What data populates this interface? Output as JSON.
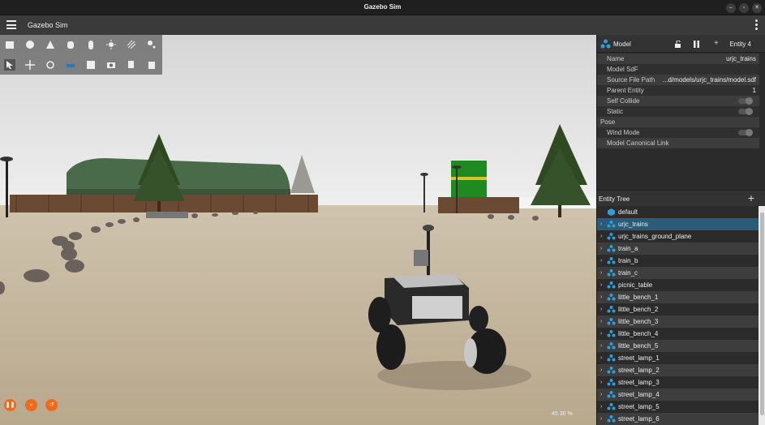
{
  "window": {
    "title": "Gazebo Sim"
  },
  "app": {
    "name": "Gazebo Sim"
  },
  "colors": {
    "accent": "#f06a1c",
    "selection": "#2a5b78",
    "panel": "#2b2b2b"
  },
  "toolbar": {
    "row1": [
      "box-icon",
      "sphere-icon",
      "cone-icon",
      "cylinder-icon",
      "capsule-icon",
      "sun-icon",
      "directional-light-icon",
      "spot-light-icon"
    ],
    "row2": [
      "select-icon",
      "translate-icon",
      "rotate-icon",
      "snap-icon",
      "grid-icon",
      "camera-icon",
      "copy-icon",
      "paste-icon"
    ]
  },
  "playback": {
    "rtf": "45.30 %"
  },
  "component_inspector": {
    "title": "Model",
    "entity": "Entity 4",
    "rows": [
      {
        "label": "Name",
        "value": "urjc_trains"
      },
      {
        "label": "Model SdF",
        "value": ""
      },
      {
        "label": "Source File Path",
        "value": "...d/models/urjc_trains/model.sdf"
      },
      {
        "label": "Parent Entity",
        "value": "1"
      },
      {
        "label": "Self Collide",
        "value": ""
      },
      {
        "label": "Static",
        "value": ""
      },
      {
        "label": "Pose",
        "value": ""
      },
      {
        "label": "Wind Mode",
        "value": ""
      },
      {
        "label": "Model Canonical Link",
        "value": ""
      }
    ]
  },
  "entity_tree": {
    "title": "Entity Tree",
    "items": [
      "default",
      "urjc_trains",
      "urjc_trains_ground_plane",
      "train_a",
      "train_b",
      "train_c",
      "picnic_table",
      "little_bench_1",
      "little_bench_2",
      "little_bench_3",
      "little_bench_4",
      "little_bench_5",
      "street_lamp_1",
      "street_lamp_2",
      "street_lamp_3",
      "street_lamp_4",
      "street_lamp_5",
      "street_lamp_6"
    ],
    "selected": 1
  }
}
